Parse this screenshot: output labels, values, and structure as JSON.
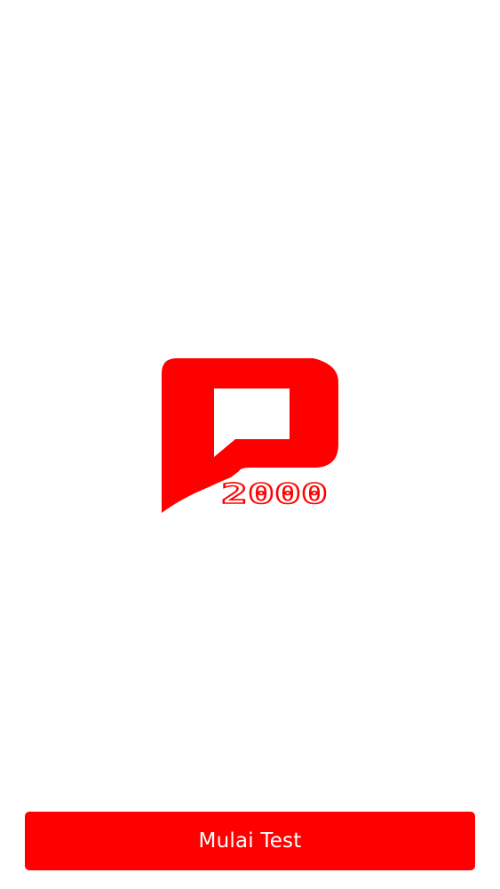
{
  "colors": {
    "brand": "#ff0000",
    "background": "#ffffff",
    "button_text": "#ffffff"
  },
  "logo": {
    "icon": "p2000-logo-icon",
    "wordmark": "2000"
  },
  "actions": {
    "start_label": "Mulai Test"
  }
}
